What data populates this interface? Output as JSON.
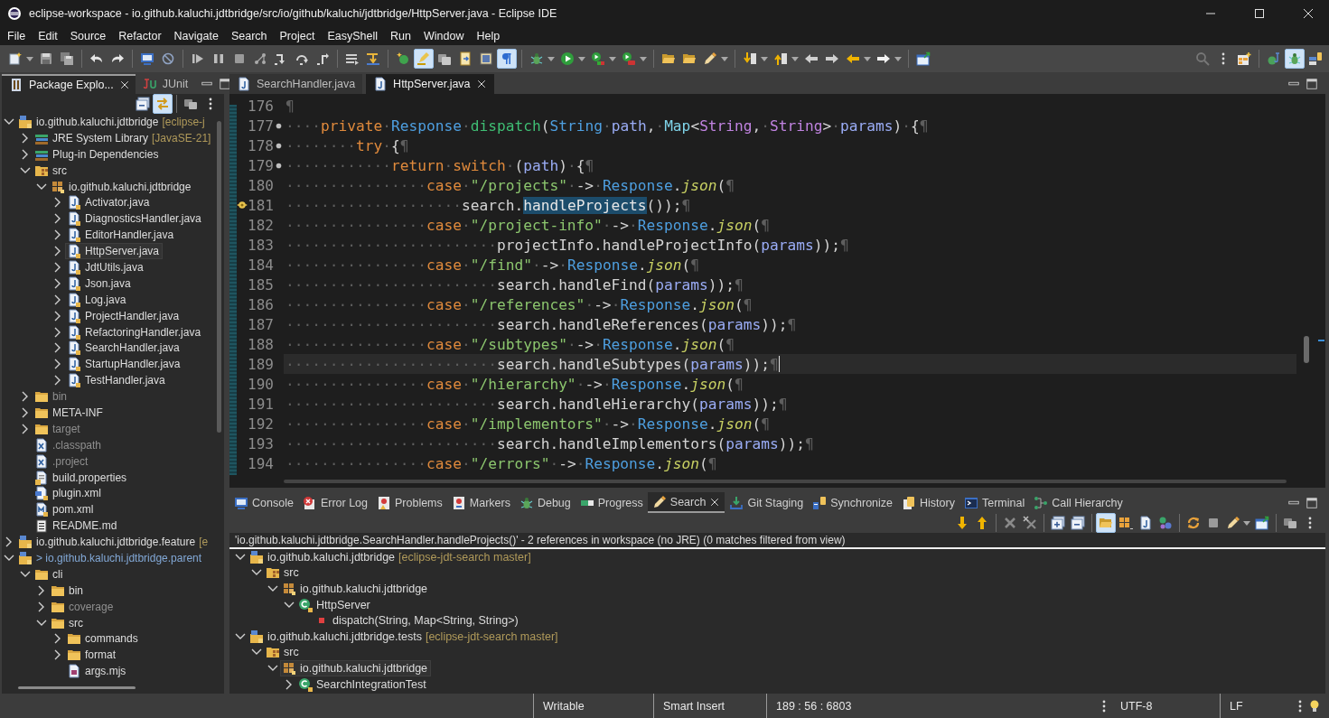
{
  "window": {
    "title": "eclipse-workspace - io.github.kaluchi.jdtbridge/src/io/github/kaluchi/jdtbridge/HttpServer.java - Eclipse IDE"
  },
  "menu": [
    "File",
    "Edit",
    "Source",
    "Refactor",
    "Navigate",
    "Search",
    "Project",
    "EasyShell",
    "Run",
    "Window",
    "Help"
  ],
  "toolbar": [
    {
      "kind": "newfile",
      "dropdown": true,
      "pressed": false
    },
    {
      "kind": "save",
      "dropdown": false,
      "pressed": false
    },
    {
      "kind": "saveall",
      "dropdown": false,
      "pressed": false
    },
    {
      "kind": "separator"
    },
    {
      "kind": "undo",
      "dropdown": false,
      "pressed": false
    },
    {
      "kind": "redo",
      "dropdown": false,
      "pressed": false
    },
    {
      "kind": "separator"
    },
    {
      "kind": "monitor",
      "dropdown": false,
      "pressed": false
    },
    {
      "kind": "skip",
      "dropdown": false,
      "pressed": false
    },
    {
      "kind": "separator"
    },
    {
      "kind": "resume",
      "dropdown": false,
      "pressed": false
    },
    {
      "kind": "pause",
      "dropdown": false,
      "pressed": false
    },
    {
      "kind": "stop",
      "dropdown": false,
      "pressed": false
    },
    {
      "kind": "nodes",
      "dropdown": false,
      "pressed": false
    },
    {
      "kind": "stepinto",
      "dropdown": false,
      "pressed": false
    },
    {
      "kind": "stepover",
      "dropdown": false,
      "pressed": false
    },
    {
      "kind": "stepreturn",
      "dropdown": false,
      "pressed": false
    },
    {
      "kind": "separator"
    },
    {
      "kind": "lines",
      "dropdown": false,
      "pressed": false
    },
    {
      "kind": "stepfilter",
      "dropdown": false,
      "pressed": false
    },
    {
      "kind": "separator"
    },
    {
      "kind": "newclass",
      "dropdown": false,
      "pressed": false
    },
    {
      "kind": "highlighter",
      "dropdown": false,
      "pressed": true
    },
    {
      "kind": "folders",
      "dropdown": false,
      "pressed": false
    },
    {
      "kind": "docarrow",
      "dropdown": false,
      "pressed": false
    },
    {
      "kind": "pane",
      "dropdown": false,
      "pressed": false
    },
    {
      "kind": "pilcrow",
      "dropdown": false,
      "pressed": true
    },
    {
      "kind": "separator"
    },
    {
      "kind": "bug",
      "dropdown": true,
      "pressed": false
    },
    {
      "kind": "run",
      "dropdown": true,
      "pressed": false
    },
    {
      "kind": "coverage",
      "dropdown": true,
      "pressed": false
    },
    {
      "kind": "exttools",
      "dropdown": true,
      "pressed": false
    },
    {
      "kind": "separator"
    },
    {
      "kind": "openfolder",
      "dropdown": false,
      "pressed": false
    },
    {
      "kind": "openfolder",
      "dropdown": false,
      "pressed": false
    },
    {
      "kind": "pencil",
      "dropdown": true,
      "pressed": false
    },
    {
      "kind": "separator"
    },
    {
      "kind": "downlist",
      "dropdown": true,
      "pressed": false
    },
    {
      "kind": "uplist",
      "dropdown": true,
      "pressed": false
    },
    {
      "kind": "backgray",
      "dropdown": false,
      "pressed": false
    },
    {
      "kind": "fwdgray",
      "dropdown": false,
      "pressed": false
    },
    {
      "kind": "back",
      "dropdown": true,
      "pressed": false
    },
    {
      "kind": "fwd",
      "dropdown": true,
      "pressed": false
    },
    {
      "kind": "separator"
    },
    {
      "kind": "window",
      "dropdown": false,
      "pressed": false
    }
  ],
  "toolbar_right": [
    {
      "kind": "search",
      "dropdown": false,
      "pressed": false
    },
    {
      "kind": "kebab",
      "dropdown": false,
      "pressed": false
    },
    {
      "kind": "perspective",
      "dropdown": false,
      "pressed": false
    },
    {
      "kind": "separator"
    },
    {
      "kind": "javapersp",
      "dropdown": false,
      "pressed": false
    },
    {
      "kind": "bug",
      "dropdown": false,
      "pressed": true
    },
    {
      "kind": "teampersp",
      "dropdown": false,
      "pressed": false
    }
  ],
  "explorer": {
    "tabs": [
      {
        "kind": "package",
        "label": "Package Explo...",
        "selected": true
      },
      {
        "kind": "junit",
        "label": "JUnit",
        "selected": false
      }
    ],
    "toolbar": [
      {
        "kind": "collapseall",
        "dropdown": false,
        "pressed": false
      },
      {
        "kind": "link",
        "dropdown": false,
        "pressed": true
      },
      {
        "kind": "separator"
      },
      {
        "kind": "filter",
        "dropdown": false,
        "pressed": false
      },
      {
        "kind": "kebab",
        "dropdown": false,
        "pressed": false
      }
    ],
    "tree": [
      {
        "kind": "project",
        "label": "io.github.kaluchi.jdtbridge",
        "decoration": "[eclipse-j",
        "dirty": false,
        "muted": false,
        "expanded": true,
        "selected": false,
        "children": [
          {
            "kind": "library",
            "label": "JRE System Library",
            "decoration": "[JavaSE-21]",
            "muted": false,
            "expanded": false,
            "selected": false
          },
          {
            "kind": "library",
            "label": "Plug-in Dependencies",
            "muted": false,
            "expanded": false,
            "selected": false
          },
          {
            "kind": "srcfolder",
            "label": "src",
            "muted": false,
            "expanded": true,
            "selected": false,
            "children": [
              {
                "kind": "package",
                "label": "io.github.kaluchi.jdtbridge",
                "muted": false,
                "expanded": true,
                "selected": false,
                "children": [
                  {
                    "kind": "javafile",
                    "label": "Activator.java",
                    "muted": false,
                    "expanded": false,
                    "selected": false
                  },
                  {
                    "kind": "javafile",
                    "label": "DiagnosticsHandler.java",
                    "muted": false,
                    "expanded": false,
                    "selected": false
                  },
                  {
                    "kind": "javafile",
                    "label": "EditorHandler.java",
                    "muted": false,
                    "expanded": false,
                    "selected": false
                  },
                  {
                    "kind": "javafile",
                    "label": "HttpServer.java",
                    "muted": false,
                    "expanded": false,
                    "selected": true
                  },
                  {
                    "kind": "javafile",
                    "label": "JdtUtils.java",
                    "muted": false,
                    "expanded": false,
                    "selected": false
                  },
                  {
                    "kind": "javafile",
                    "label": "Json.java",
                    "muted": false,
                    "expanded": false,
                    "selected": false
                  },
                  {
                    "kind": "javafile",
                    "label": "Log.java",
                    "muted": false,
                    "expanded": false,
                    "selected": false
                  },
                  {
                    "kind": "javafile",
                    "label": "ProjectHandler.java",
                    "muted": false,
                    "expanded": false,
                    "selected": false
                  },
                  {
                    "kind": "javafile",
                    "label": "RefactoringHandler.java",
                    "muted": false,
                    "expanded": false,
                    "selected": false
                  },
                  {
                    "kind": "javafile",
                    "label": "SearchHandler.java",
                    "muted": false,
                    "expanded": false,
                    "selected": false
                  },
                  {
                    "kind": "javafile",
                    "label": "StartupHandler.java",
                    "muted": false,
                    "expanded": false,
                    "selected": false
                  },
                  {
                    "kind": "javafile",
                    "label": "TestHandler.java",
                    "muted": false,
                    "expanded": false,
                    "selected": false
                  }
                ]
              }
            ]
          },
          {
            "kind": "folder",
            "label": "bin",
            "muted": true,
            "expanded": false,
            "selected": false
          },
          {
            "kind": "folder",
            "label": "META-INF",
            "muted": false,
            "expanded": false,
            "selected": false
          },
          {
            "kind": "folder",
            "label": "target",
            "muted": true,
            "expanded": false,
            "selected": false
          },
          {
            "kind": "xmlfile",
            "label": ".classpath",
            "muted": true,
            "selected": false
          },
          {
            "kind": "xmlfile",
            "label": ".project",
            "muted": true,
            "selected": false
          },
          {
            "kind": "propfile",
            "label": "build.properties",
            "muted": false,
            "selected": false
          },
          {
            "kind": "pluginfile",
            "label": "plugin.xml",
            "muted": false,
            "selected": false
          },
          {
            "kind": "pomfile",
            "label": "pom.xml",
            "muted": false,
            "selected": false
          },
          {
            "kind": "textfile",
            "label": "README.md",
            "muted": false,
            "selected": false
          }
        ]
      },
      {
        "kind": "project",
        "label": "io.github.kaluchi.jdtbridge.feature",
        "decoration": "[e",
        "dirty": false,
        "muted": false,
        "expanded": false,
        "selected": false
      },
      {
        "kind": "project",
        "label": "> io.github.kaluchi.jdtbridge.parent",
        "dirty": true,
        "muted": false,
        "expanded": true,
        "selected": false,
        "children": [
          {
            "kind": "folder",
            "label": "cli",
            "muted": false,
            "expanded": true,
            "selected": false,
            "children": [
              {
                "kind": "folder",
                "label": "bin",
                "muted": false,
                "expanded": false,
                "selected": false
              },
              {
                "kind": "folder",
                "label": "coverage",
                "muted": true,
                "expanded": false,
                "selected": false
              },
              {
                "kind": "folder",
                "label": "src",
                "muted": false,
                "expanded": true,
                "selected": false,
                "children": [
                  {
                    "kind": "folder",
                    "label": "commands",
                    "muted": false,
                    "expanded": false,
                    "selected": false
                  },
                  {
                    "kind": "folder",
                    "label": "format",
                    "muted": false,
                    "expanded": false,
                    "selected": false
                  },
                  {
                    "kind": "scriptfile",
                    "label": "args.mjs",
                    "muted": false,
                    "selected": false
                  }
                ]
              }
            ]
          }
        ]
      }
    ]
  },
  "editor": {
    "tabs": [
      {
        "label": "SearchHandler.java",
        "selected": false
      },
      {
        "label": "HttpServer.java",
        "selected": true
      }
    ],
    "lines": [
      {
        "number": "176",
        "fold": false,
        "marker": false,
        "current": false,
        "code": [
          {
            "kind": "ws",
            "text": "¶"
          }
        ]
      },
      {
        "number": "177",
        "fold": true,
        "marker": false,
        "current": false,
        "code": [
          {
            "kind": "ws",
            "text": "····"
          },
          {
            "kind": "kw",
            "text": "private"
          },
          {
            "kind": "ws",
            "text": "·"
          },
          {
            "kind": "type",
            "text": "Response"
          },
          {
            "kind": "ws",
            "text": "·"
          },
          {
            "kind": "method",
            "text": "dispatch"
          },
          {
            "kind": "p",
            "text": "("
          },
          {
            "kind": "type",
            "text": "String"
          },
          {
            "kind": "ws",
            "text": "·"
          },
          {
            "kind": "param",
            "text": "path"
          },
          {
            "kind": "p",
            "text": ","
          },
          {
            "kind": "ws",
            "text": "·"
          },
          {
            "kind": "map",
            "text": "Map"
          },
          {
            "kind": "p",
            "text": "<"
          },
          {
            "kind": "gen",
            "text": "String"
          },
          {
            "kind": "p",
            "text": ","
          },
          {
            "kind": "ws",
            "text": "·"
          },
          {
            "kind": "gen",
            "text": "String"
          },
          {
            "kind": "p",
            "text": ">"
          },
          {
            "kind": "ws",
            "text": "·"
          },
          {
            "kind": "param",
            "text": "params"
          },
          {
            "kind": "p",
            "text": ")"
          },
          {
            "kind": "ws",
            "text": "·"
          },
          {
            "kind": "p",
            "text": "{"
          },
          {
            "kind": "ws",
            "text": "¶"
          }
        ]
      },
      {
        "number": "178",
        "fold": true,
        "marker": false,
        "current": false,
        "code": [
          {
            "kind": "ws",
            "text": "········"
          },
          {
            "kind": "kw",
            "text": "try"
          },
          {
            "kind": "ws",
            "text": "·"
          },
          {
            "kind": "p",
            "text": "{"
          },
          {
            "kind": "ws",
            "text": "¶"
          }
        ]
      },
      {
        "number": "179",
        "fold": true,
        "marker": false,
        "current": false,
        "code": [
          {
            "kind": "ws",
            "text": "············"
          },
          {
            "kind": "kw",
            "text": "return"
          },
          {
            "kind": "ws",
            "text": "·"
          },
          {
            "kind": "kw",
            "text": "switch"
          },
          {
            "kind": "ws",
            "text": "·"
          },
          {
            "kind": "p",
            "text": "("
          },
          {
            "kind": "param",
            "text": "path"
          },
          {
            "kind": "p",
            "text": ")"
          },
          {
            "kind": "ws",
            "text": "·"
          },
          {
            "kind": "p",
            "text": "{"
          },
          {
            "kind": "ws",
            "text": "¶"
          }
        ]
      },
      {
        "number": "180",
        "fold": false,
        "marker": false,
        "current": false,
        "code": [
          {
            "kind": "ws",
            "text": "················"
          },
          {
            "kind": "kw",
            "text": "case"
          },
          {
            "kind": "ws",
            "text": "·"
          },
          {
            "kind": "str",
            "text": "\"/projects\""
          },
          {
            "kind": "ws",
            "text": "·"
          },
          {
            "kind": "p",
            "text": "->"
          },
          {
            "kind": "ws",
            "text": "·"
          },
          {
            "kind": "type",
            "text": "Response"
          },
          {
            "kind": "p",
            "text": "."
          },
          {
            "kind": "static",
            "text": "json"
          },
          {
            "kind": "p",
            "text": "("
          },
          {
            "kind": "ws",
            "text": "¶"
          }
        ]
      },
      {
        "number": "181",
        "fold": false,
        "marker": true,
        "current": false,
        "code": [
          {
            "kind": "ws",
            "text": "····················"
          },
          {
            "kind": "p",
            "text": "search."
          },
          {
            "kind": "hl",
            "text": "handleProjects"
          },
          {
            "kind": "p",
            "text": "());"
          },
          {
            "kind": "ws",
            "text": "¶"
          }
        ]
      },
      {
        "number": "182",
        "fold": false,
        "marker": false,
        "current": false,
        "code": [
          {
            "kind": "ws",
            "text": "················"
          },
          {
            "kind": "kw",
            "text": "case"
          },
          {
            "kind": "ws",
            "text": "·"
          },
          {
            "kind": "str",
            "text": "\"/project-info\""
          },
          {
            "kind": "ws",
            "text": "·"
          },
          {
            "kind": "p",
            "text": "->"
          },
          {
            "kind": "ws",
            "text": "·"
          },
          {
            "kind": "type",
            "text": "Response"
          },
          {
            "kind": "p",
            "text": "."
          },
          {
            "kind": "static",
            "text": "json"
          },
          {
            "kind": "p",
            "text": "("
          },
          {
            "kind": "ws",
            "text": "¶"
          }
        ]
      },
      {
        "number": "183",
        "fold": false,
        "marker": false,
        "current": false,
        "code": [
          {
            "kind": "ws",
            "text": "························"
          },
          {
            "kind": "p",
            "text": "projectInfo.handleProjectInfo("
          },
          {
            "kind": "param",
            "text": "params"
          },
          {
            "kind": "p",
            "text": "));"
          },
          {
            "kind": "ws",
            "text": "¶"
          }
        ]
      },
      {
        "number": "184",
        "fold": false,
        "marker": false,
        "current": false,
        "code": [
          {
            "kind": "ws",
            "text": "················"
          },
          {
            "kind": "kw",
            "text": "case"
          },
          {
            "kind": "ws",
            "text": "·"
          },
          {
            "kind": "str",
            "text": "\"/find\""
          },
          {
            "kind": "ws",
            "text": "·"
          },
          {
            "kind": "p",
            "text": "->"
          },
          {
            "kind": "ws",
            "text": "·"
          },
          {
            "kind": "type",
            "text": "Response"
          },
          {
            "kind": "p",
            "text": "."
          },
          {
            "kind": "static",
            "text": "json"
          },
          {
            "kind": "p",
            "text": "("
          },
          {
            "kind": "ws",
            "text": "¶"
          }
        ]
      },
      {
        "number": "185",
        "fold": false,
        "marker": false,
        "current": false,
        "code": [
          {
            "kind": "ws",
            "text": "························"
          },
          {
            "kind": "p",
            "text": "search.handleFind("
          },
          {
            "kind": "param",
            "text": "params"
          },
          {
            "kind": "p",
            "text": "));"
          },
          {
            "kind": "ws",
            "text": "¶"
          }
        ]
      },
      {
        "number": "186",
        "fold": false,
        "marker": false,
        "current": false,
        "code": [
          {
            "kind": "ws",
            "text": "················"
          },
          {
            "kind": "kw",
            "text": "case"
          },
          {
            "kind": "ws",
            "text": "·"
          },
          {
            "kind": "str",
            "text": "\"/references\""
          },
          {
            "kind": "ws",
            "text": "·"
          },
          {
            "kind": "p",
            "text": "->"
          },
          {
            "kind": "ws",
            "text": "·"
          },
          {
            "kind": "type",
            "text": "Response"
          },
          {
            "kind": "p",
            "text": "."
          },
          {
            "kind": "static",
            "text": "json"
          },
          {
            "kind": "p",
            "text": "("
          },
          {
            "kind": "ws",
            "text": "¶"
          }
        ]
      },
      {
        "number": "187",
        "fold": false,
        "marker": false,
        "current": false,
        "code": [
          {
            "kind": "ws",
            "text": "························"
          },
          {
            "kind": "p",
            "text": "search.handleReferences("
          },
          {
            "kind": "param",
            "text": "params"
          },
          {
            "kind": "p",
            "text": "));"
          },
          {
            "kind": "ws",
            "text": "¶"
          }
        ]
      },
      {
        "number": "188",
        "fold": false,
        "marker": false,
        "current": false,
        "code": [
          {
            "kind": "ws",
            "text": "················"
          },
          {
            "kind": "kw",
            "text": "case"
          },
          {
            "kind": "ws",
            "text": "·"
          },
          {
            "kind": "str",
            "text": "\"/subtypes\""
          },
          {
            "kind": "ws",
            "text": "·"
          },
          {
            "kind": "p",
            "text": "->"
          },
          {
            "kind": "ws",
            "text": "·"
          },
          {
            "kind": "type",
            "text": "Response"
          },
          {
            "kind": "p",
            "text": "."
          },
          {
            "kind": "static",
            "text": "json"
          },
          {
            "kind": "p",
            "text": "("
          },
          {
            "kind": "ws",
            "text": "¶"
          }
        ]
      },
      {
        "number": "189",
        "fold": false,
        "marker": false,
        "current": true,
        "code": [
          {
            "kind": "ws",
            "text": "························"
          },
          {
            "kind": "p",
            "text": "search.handleSubtypes("
          },
          {
            "kind": "param",
            "text": "params"
          },
          {
            "kind": "p",
            "text": "));"
          },
          {
            "kind": "ws",
            "text": "¶"
          }
        ]
      },
      {
        "number": "190",
        "fold": false,
        "marker": false,
        "current": false,
        "code": [
          {
            "kind": "ws",
            "text": "················"
          },
          {
            "kind": "kw",
            "text": "case"
          },
          {
            "kind": "ws",
            "text": "·"
          },
          {
            "kind": "str",
            "text": "\"/hierarchy\""
          },
          {
            "kind": "ws",
            "text": "·"
          },
          {
            "kind": "p",
            "text": "->"
          },
          {
            "kind": "ws",
            "text": "·"
          },
          {
            "kind": "type",
            "text": "Response"
          },
          {
            "kind": "p",
            "text": "."
          },
          {
            "kind": "static",
            "text": "json"
          },
          {
            "kind": "p",
            "text": "("
          },
          {
            "kind": "ws",
            "text": "¶"
          }
        ]
      },
      {
        "number": "191",
        "fold": false,
        "marker": false,
        "current": false,
        "code": [
          {
            "kind": "ws",
            "text": "························"
          },
          {
            "kind": "p",
            "text": "search.handleHierarchy("
          },
          {
            "kind": "param",
            "text": "params"
          },
          {
            "kind": "p",
            "text": "));"
          },
          {
            "kind": "ws",
            "text": "¶"
          }
        ]
      },
      {
        "number": "192",
        "fold": false,
        "marker": false,
        "current": false,
        "code": [
          {
            "kind": "ws",
            "text": "················"
          },
          {
            "kind": "kw",
            "text": "case"
          },
          {
            "kind": "ws",
            "text": "·"
          },
          {
            "kind": "str",
            "text": "\"/implementors\""
          },
          {
            "kind": "ws",
            "text": "·"
          },
          {
            "kind": "p",
            "text": "->"
          },
          {
            "kind": "ws",
            "text": "·"
          },
          {
            "kind": "type",
            "text": "Response"
          },
          {
            "kind": "p",
            "text": "."
          },
          {
            "kind": "static",
            "text": "json"
          },
          {
            "kind": "p",
            "text": "("
          },
          {
            "kind": "ws",
            "text": "¶"
          }
        ]
      },
      {
        "number": "193",
        "fold": false,
        "marker": false,
        "current": false,
        "code": [
          {
            "kind": "ws",
            "text": "························"
          },
          {
            "kind": "p",
            "text": "search.handleImplementors("
          },
          {
            "kind": "param",
            "text": "params"
          },
          {
            "kind": "p",
            "text": "));"
          },
          {
            "kind": "ws",
            "text": "¶"
          }
        ]
      },
      {
        "number": "194",
        "fold": false,
        "marker": false,
        "current": false,
        "code": [
          {
            "kind": "ws",
            "text": "················"
          },
          {
            "kind": "kw",
            "text": "case"
          },
          {
            "kind": "ws",
            "text": "·"
          },
          {
            "kind": "str",
            "text": "\"/errors\""
          },
          {
            "kind": "ws",
            "text": "·"
          },
          {
            "kind": "p",
            "text": "->"
          },
          {
            "kind": "ws",
            "text": "·"
          },
          {
            "kind": "type",
            "text": "Response"
          },
          {
            "kind": "p",
            "text": "."
          },
          {
            "kind": "static",
            "text": "json"
          },
          {
            "kind": "p",
            "text": "("
          },
          {
            "kind": "ws",
            "text": "¶"
          }
        ]
      }
    ]
  },
  "views": {
    "tabs": [
      {
        "kind": "monitor",
        "label": "Console",
        "selected": false
      },
      {
        "kind": "errorlog",
        "label": "Error Log",
        "selected": false
      },
      {
        "kind": "problems",
        "label": "Problems",
        "selected": false
      },
      {
        "kind": "markers",
        "label": "Markers",
        "selected": false
      },
      {
        "kind": "bug",
        "label": "Debug",
        "selected": false
      },
      {
        "kind": "progress",
        "label": "Progress",
        "selected": false
      },
      {
        "kind": "pencil",
        "label": "Search",
        "selected": true
      },
      {
        "kind": "download",
        "label": "Git Staging",
        "selected": false
      },
      {
        "kind": "sync",
        "label": "Synchronize",
        "selected": false
      },
      {
        "kind": "history",
        "label": "History",
        "selected": false
      },
      {
        "kind": "terminal",
        "label": "Terminal",
        "selected": false
      },
      {
        "kind": "hierarchy",
        "label": "Call Hierarchy",
        "selected": false
      }
    ],
    "toolbar": [
      {
        "kind": "arrowdown",
        "dropdown": false,
        "pressed": false
      },
      {
        "kind": "arrowup",
        "dropdown": false,
        "pressed": false
      },
      {
        "kind": "separator"
      },
      {
        "kind": "remove",
        "dropdown": false,
        "pressed": false
      },
      {
        "kind": "removeall",
        "dropdown": false,
        "pressed": false
      },
      {
        "kind": "separator"
      },
      {
        "kind": "expandall",
        "dropdown": false,
        "pressed": false
      },
      {
        "kind": "collapseall",
        "dropdown": false,
        "pressed": false
      },
      {
        "kind": "separator"
      },
      {
        "kind": "openfolder",
        "dropdown": false,
        "pressed": true
      },
      {
        "kind": "grid",
        "dropdown": false,
        "pressed": false
      },
      {
        "kind": "jfile",
        "dropdown": false,
        "pressed": false
      },
      {
        "kind": "balls",
        "dropdown": false,
        "pressed": false
      },
      {
        "kind": "separator"
      },
      {
        "kind": "refresh",
        "dropdown": false,
        "pressed": false
      },
      {
        "kind": "stop",
        "dropdown": false,
        "pressed": false
      },
      {
        "kind": "pencil",
        "dropdown": true,
        "pressed": false
      },
      {
        "kind": "window",
        "dropdown": false,
        "pressed": false
      },
      {
        "kind": "separator"
      },
      {
        "kind": "filter",
        "dropdown": false,
        "pressed": false
      },
      {
        "kind": "kebab",
        "dropdown": false,
        "pressed": false
      }
    ],
    "summary": "'io.github.kaluchi.jdtbridge.SearchHandler.handleProjects()' - 2 references in workspace (no JRE) (0 matches filtered from view)",
    "results": [
      {
        "kind": "project",
        "label": "io.github.kaluchi.jdtbridge",
        "decoration": "[eclipse-jdt-search master]",
        "expanded": true,
        "selected": false,
        "children": [
          {
            "kind": "srcfolder",
            "label": "src",
            "expanded": true,
            "selected": false,
            "children": [
              {
                "kind": "package",
                "label": "io.github.kaluchi.jdtbridge",
                "expanded": true,
                "selected": false,
                "children": [
                  {
                    "kind": "class",
                    "label": "HttpServer",
                    "expanded": true,
                    "selected": false,
                    "children": [
                      {
                        "kind": "method",
                        "label": "dispatch(String, Map<String, String>)",
                        "selected": false
                      }
                    ]
                  }
                ]
              }
            ]
          }
        ]
      },
      {
        "kind": "project",
        "label": "io.github.kaluchi.jdtbridge.tests",
        "decoration": "[eclipse-jdt-search master]",
        "expanded": true,
        "selected": false,
        "children": [
          {
            "kind": "srcfolder",
            "label": "src",
            "expanded": true,
            "selected": false,
            "children": [
              {
                "kind": "package",
                "label": "io.github.kaluchi.jdtbridge",
                "expanded": true,
                "selected": true,
                "children": [
                  {
                    "kind": "class",
                    "label": "SearchIntegrationTest",
                    "expanded": false,
                    "selected": false
                  }
                ]
              }
            ]
          }
        ]
      }
    ]
  },
  "status_bar": [
    "Writable",
    "Smart Insert",
    "189 : 56 : 6803",
    "UTF-8",
    "LF"
  ]
}
